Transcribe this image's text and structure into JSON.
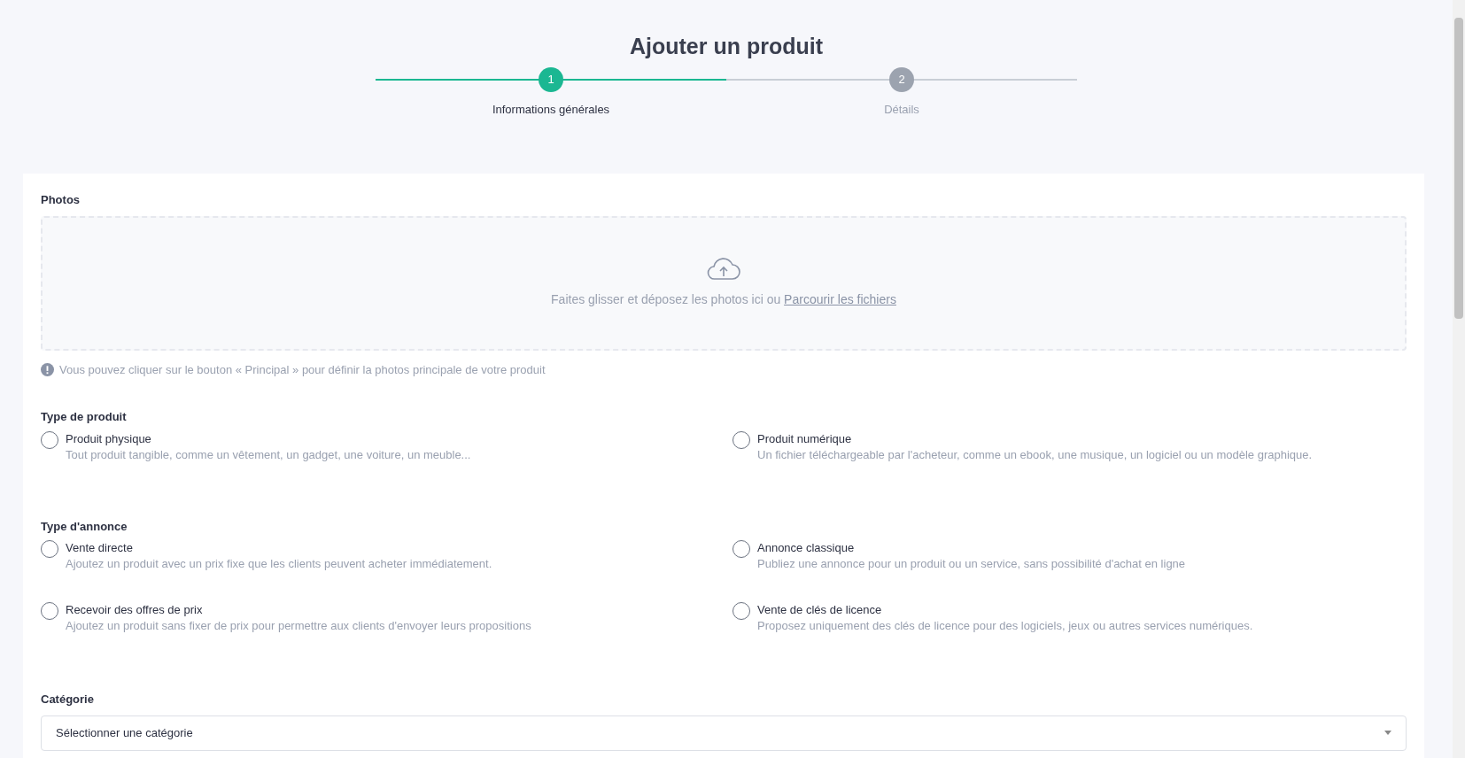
{
  "title": "Ajouter un produit",
  "steps": [
    {
      "number": "1",
      "label": "Informations générales",
      "active": true
    },
    {
      "number": "2",
      "label": "Détails",
      "active": false
    }
  ],
  "photos": {
    "label": "Photos",
    "drop_text": "Faites glisser et déposez les photos ici ou",
    "browse_link": "Parcourir les fichiers",
    "hint": "Vous pouvez cliquer sur le bouton « Principal » pour définir la photos principale de votre produit"
  },
  "product_type": {
    "label": "Type de produit",
    "options": [
      {
        "title": "Produit physique",
        "description": "Tout produit tangible, comme un vêtement, un gadget, une voiture, un meuble...",
        "selected": false
      },
      {
        "title": "Produit numérique",
        "description": "Un fichier téléchargeable par l'acheteur, comme un ebook, une musique, un logiciel ou un modèle graphique.",
        "selected": false
      }
    ]
  },
  "listing_type": {
    "label": "Type d'annonce",
    "options": [
      {
        "title": "Vente directe",
        "description": "Ajoutez un produit avec un prix fixe que les clients peuvent acheter immédiatement.",
        "selected": false
      },
      {
        "title": "Annonce classique",
        "description": "Publiez une annonce pour un produit ou un service, sans possibilité d'achat en ligne",
        "selected": false
      },
      {
        "title": "Recevoir des offres de prix",
        "description": "Ajoutez un produit sans fixer de prix pour permettre aux clients d'envoyer leurs propositions",
        "selected": false
      },
      {
        "title": "Vente de clés de licence",
        "description": "Proposez uniquement des clés de licence pour des logiciels, jeux ou autres services numériques.",
        "selected": false
      }
    ]
  },
  "category": {
    "label": "Catégorie",
    "placeholder": "Sélectionner une catégorie"
  }
}
